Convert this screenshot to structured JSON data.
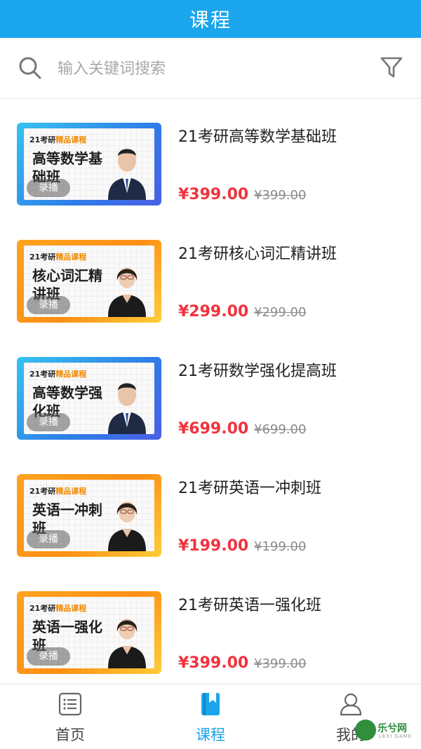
{
  "header": {
    "title": "课程"
  },
  "search": {
    "placeholder": "输入关键词搜索"
  },
  "courses": [
    {
      "title": "21考研高等数学基础班",
      "price": "¥399.00",
      "old_price": "¥399.00",
      "badge": "录播",
      "thumb_tag": "21考研",
      "thumb_tag_hl": "精品课程",
      "thumb_title": "高等数学基础班",
      "theme": "blue"
    },
    {
      "title": "21考研核心词汇精讲班",
      "price": "¥299.00",
      "old_price": "¥299.00",
      "badge": "录播",
      "thumb_tag": "21考研",
      "thumb_tag_hl": "精品课程",
      "thumb_title": "核心词汇精讲班",
      "theme": "orange"
    },
    {
      "title": "21考研数学强化提高班",
      "price": "¥699.00",
      "old_price": "¥699.00",
      "badge": "录播",
      "thumb_tag": "21考研",
      "thumb_tag_hl": "精品课程",
      "thumb_title": "高等数学强化班",
      "theme": "blue"
    },
    {
      "title": "21考研英语一冲刺班",
      "price": "¥199.00",
      "old_price": "¥199.00",
      "badge": "录播",
      "thumb_tag": "21考研",
      "thumb_tag_hl": "精品课程",
      "thumb_title": "英语一冲刺班",
      "theme": "orange"
    },
    {
      "title": "21考研英语一强化班",
      "price": "¥399.00",
      "old_price": "¥399.00",
      "badge": "录播",
      "thumb_tag": "21考研",
      "thumb_tag_hl": "精品课程",
      "thumb_title": "英语一强化班",
      "theme": "orange"
    }
  ],
  "tabbar": {
    "items": [
      {
        "label": "首页",
        "icon": "list-icon",
        "active": false
      },
      {
        "label": "课程",
        "icon": "bookmark-book-icon",
        "active": true
      },
      {
        "label": "我的",
        "icon": "user-icon",
        "active": false
      }
    ]
  },
  "watermark": {
    "text": "乐兮网",
    "sub": "LEXI GAME"
  },
  "colors": {
    "accent": "#1aa5ec",
    "price": "#f0333d"
  }
}
